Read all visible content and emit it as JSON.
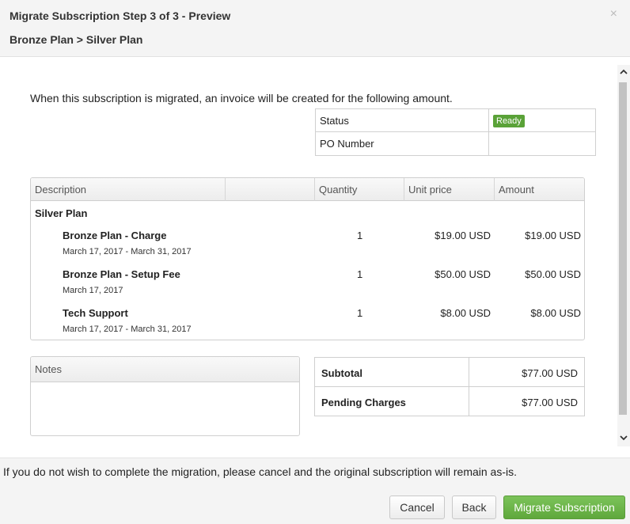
{
  "dialog": {
    "title": "Migrate Subscription Step 3 of 3",
    "title_sep": " - ",
    "title_step": "Preview",
    "breadcrumb": "Bronze Plan > Silver Plan",
    "close_glyph": "×"
  },
  "intro": "When this subscription is migrated, an invoice will be created for the following amount.",
  "status_table": {
    "status_label": "Status",
    "status_value": "Ready",
    "po_label": "PO Number",
    "po_value": ""
  },
  "items_table": {
    "columns": [
      "Description",
      "Quantity",
      "Unit price",
      "Amount"
    ],
    "group": "Silver Plan",
    "rows": [
      {
        "name": "Bronze Plan - Charge",
        "date": "March 17, 2017 - March 31, 2017",
        "quantity": "1",
        "unit_price": "$19.00 USD",
        "amount": "$19.00 USD"
      },
      {
        "name": "Bronze Plan - Setup Fee",
        "date": "March 17, 2017",
        "quantity": "1",
        "unit_price": "$50.00 USD",
        "amount": "$50.00 USD"
      },
      {
        "name": "Tech Support",
        "date": "March 17, 2017 - March 31, 2017",
        "quantity": "1",
        "unit_price": "$8.00 USD",
        "amount": "$8.00 USD"
      }
    ]
  },
  "notes": {
    "label": "Notes"
  },
  "totals": {
    "subtotal_label": "Subtotal",
    "subtotal_value": "$77.00 USD",
    "pending_label": "Pending Charges",
    "pending_value": "$77.00 USD"
  },
  "footer": {
    "message": "If you do not wish to complete the migration, please cancel and the original subscription will remain as-is.",
    "cancel_label": "Cancel",
    "back_label": "Back",
    "migrate_label": "Migrate Subscription"
  },
  "colors": {
    "accent_green": "#5fa83c",
    "ready_badge": "#5aa238"
  },
  "icons": {
    "close": "close-icon",
    "scroll_up": "chevron-up-icon",
    "scroll_down": "chevron-down-icon"
  }
}
